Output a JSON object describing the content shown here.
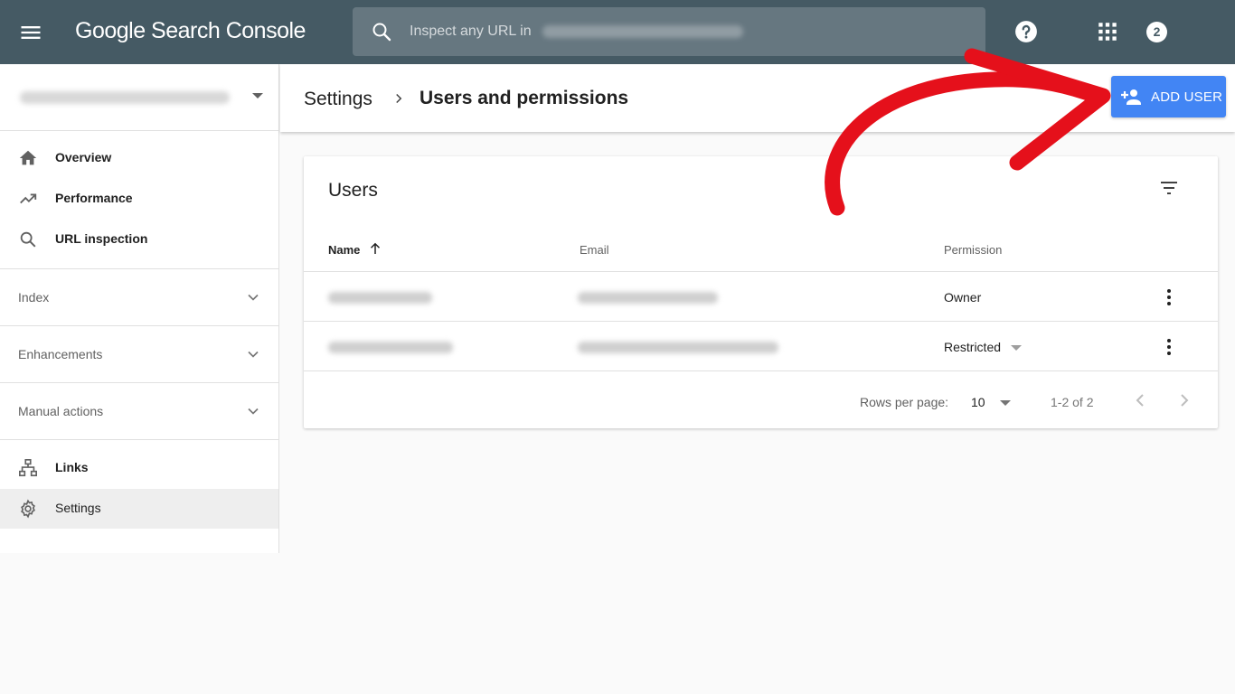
{
  "topbar": {
    "app_title": "Google Search Console",
    "search_placeholder": "Inspect any URL in",
    "notification_count": "2",
    "icons": [
      "menu-icon",
      "search-icon",
      "help-icon",
      "apps-icon"
    ]
  },
  "sidebar": {
    "nav": [
      {
        "label": "Overview",
        "icon": "home-icon"
      },
      {
        "label": "Performance",
        "icon": "trending-up-icon"
      },
      {
        "label": "URL inspection",
        "icon": "search-icon"
      }
    ],
    "sections": [
      {
        "label": "Index"
      },
      {
        "label": "Enhancements"
      },
      {
        "label": "Manual actions"
      }
    ],
    "bottom": [
      {
        "label": "Links",
        "icon": "links-icon"
      },
      {
        "label": "Settings",
        "icon": "gear-icon",
        "active": true
      }
    ]
  },
  "header": {
    "breadcrumb_parent": "Settings",
    "breadcrumb_current": "Users and permissions",
    "add_user_label": "ADD USER"
  },
  "users_card": {
    "title": "Users",
    "columns": {
      "name": "Name",
      "email": "Email",
      "permission": "Permission"
    },
    "rows": [
      {
        "permission": "Owner"
      },
      {
        "permission": "Restricted"
      }
    ],
    "footer": {
      "rows_per_page_label": "Rows per page:",
      "rows_per_page_value": "10",
      "range": "1-2 of 2"
    }
  },
  "colors": {
    "topbar": "#455a64",
    "accent": "#4285f4",
    "annotation_arrow": "#e5101b"
  }
}
